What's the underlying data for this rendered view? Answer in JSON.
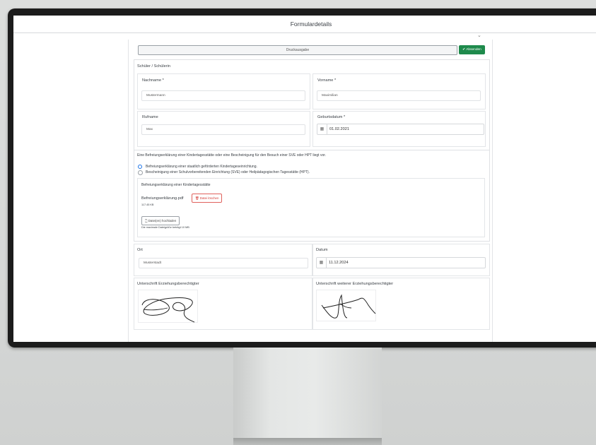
{
  "window": {
    "title": "Formulardetails"
  },
  "toolbar": {
    "print_label": "Druckausgabe",
    "send_label": "✔ Absenden"
  },
  "student": {
    "section_title": "Schüler / Schülerin",
    "lastname_label": "Nachname *",
    "lastname_value": "Mustermann",
    "firstname_label": "Vorname *",
    "firstname_value": "Maximilian",
    "nickname_label": "Rufname",
    "nickname_value": "Max",
    "birthdate_label": "Geburtsdatum *",
    "birthdate_value": "01.02.2021"
  },
  "exemption": {
    "intro": "Eine Befreiungserklärung einer Kindertagesstätte oder eine Bescheinigung für den Besuch einer SVE oder HPT liegt vor.",
    "options": [
      "Befreiungserklärung einer staatlich geförderten Kindertageseinrichtung.",
      "Bescheinigung einer Schulvorbereitenden Einrichtung (SVE) oder Heilpädagogischen Tagesstätte (HPT)."
    ],
    "selected_index": 0,
    "upload_title": "Befreiungserklärung einer Kindertagesstätte",
    "file_name": "Befreiungserklärung.pdf",
    "file_size": "117.45 KB",
    "delete_label": "🗑 Datei löschen",
    "upload_label": "🗋 Datei(en) hochladen",
    "max_size_note": "Die maximale Dateigröße beträgt 10 MB"
  },
  "place": {
    "place_label": "Ort",
    "place_value": "Musterstadt",
    "date_label": "Datum",
    "date_value": "11.12.2024"
  },
  "signatures": {
    "guardian_label": "Unterschrift Erziehungsberechtigter",
    "other_guardian_label": "Unterschrift weiterer Erziehungsberechtigter"
  },
  "icons": {
    "calendar": "calendar-icon",
    "trash": "trash-icon",
    "file": "file-icon",
    "check": "check-icon",
    "chevron": "chevron-down-icon"
  },
  "colors": {
    "send": "#1e8a4c",
    "delete": "#d33b35",
    "radio": "#1a73e8"
  }
}
